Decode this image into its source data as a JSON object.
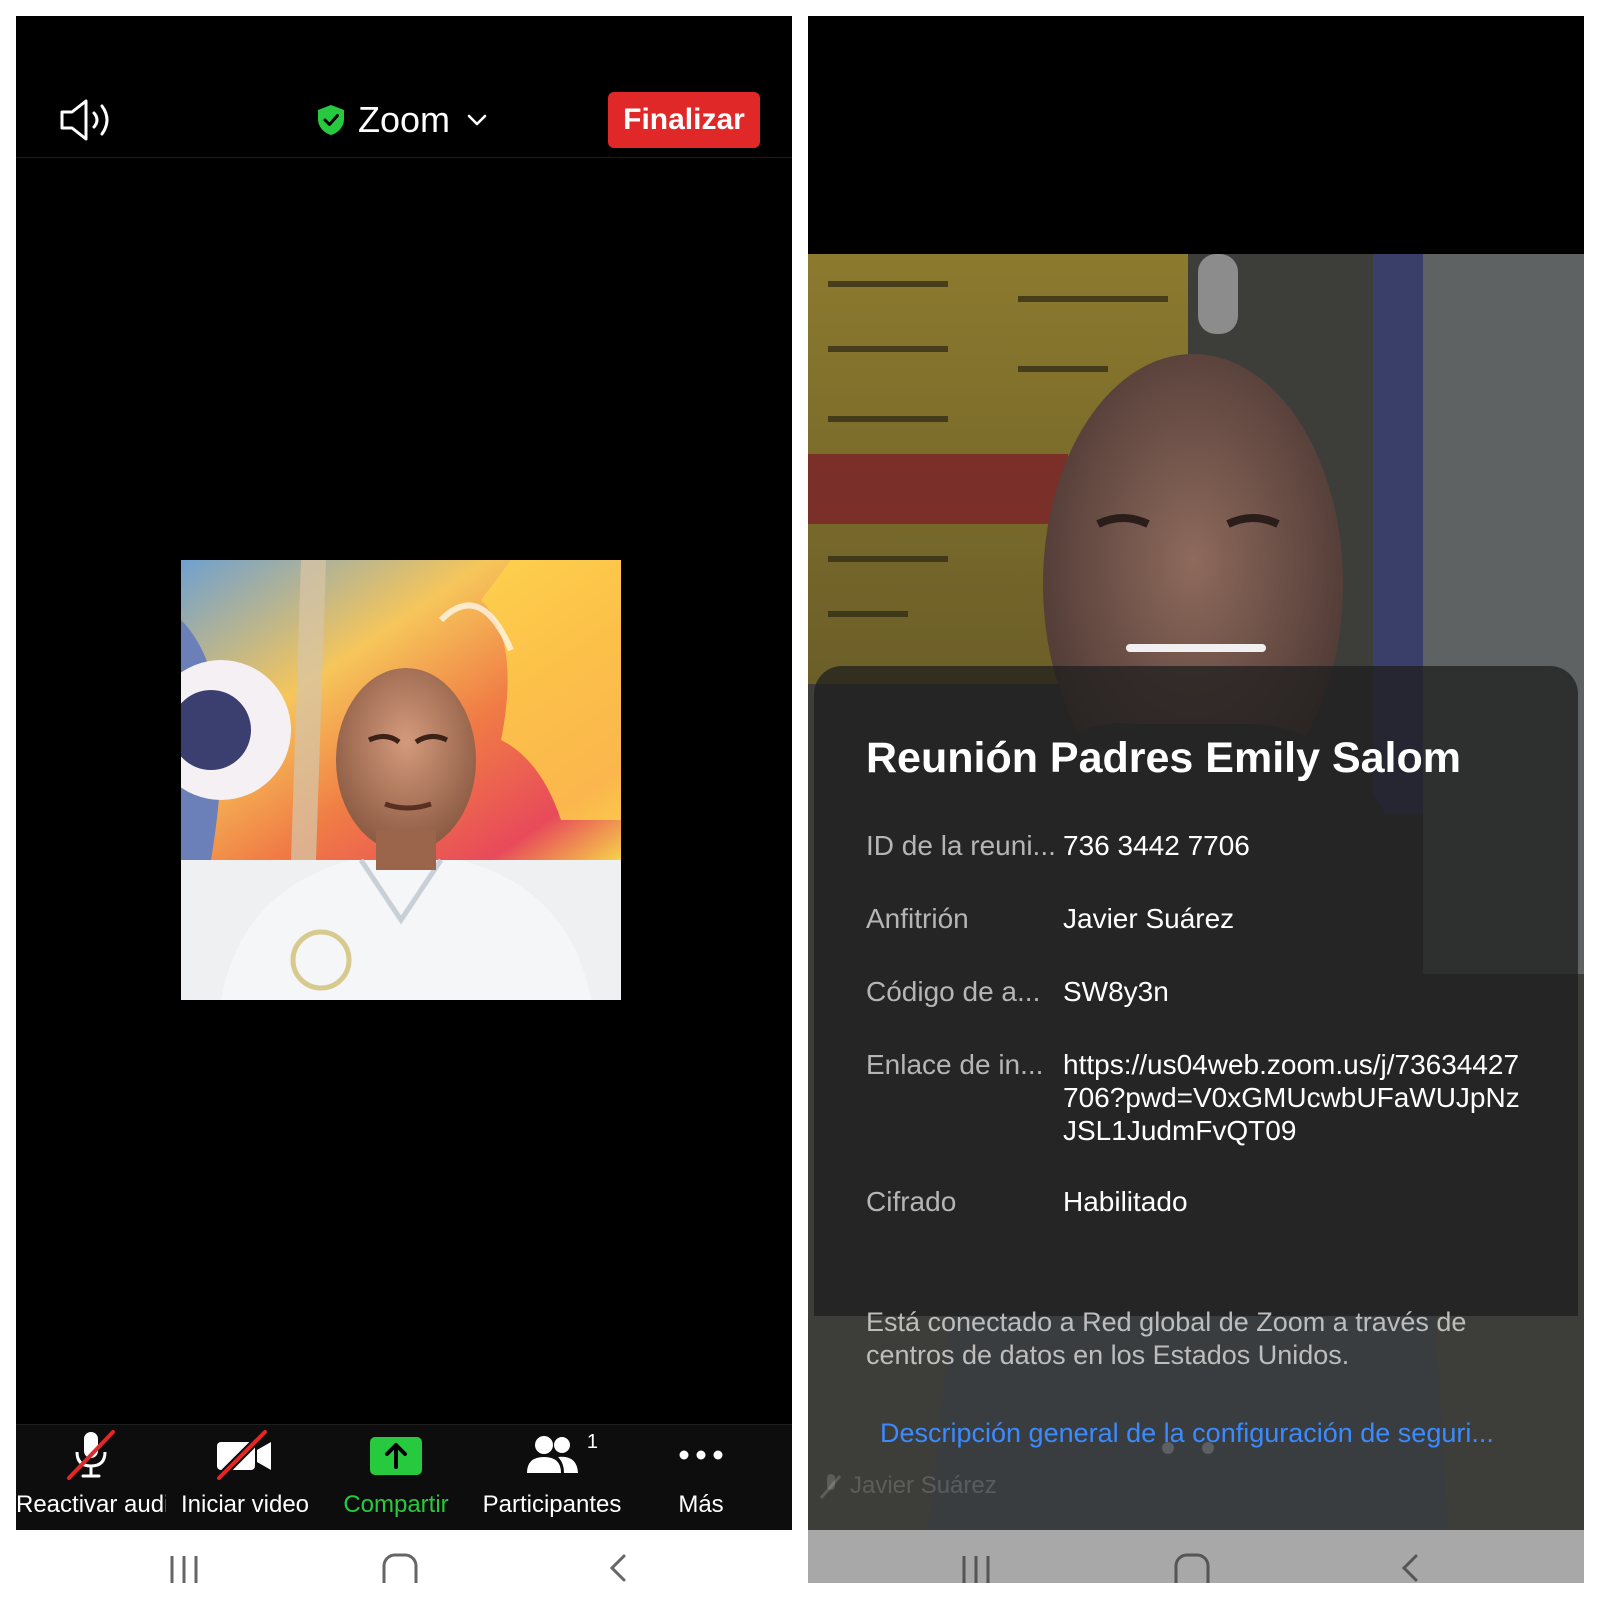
{
  "left": {
    "header": {
      "meeting_name": "Zoom",
      "end_button_label": "Finalizar",
      "speaker_icon": "speaker-icon",
      "shield_icon": "shield-check-icon",
      "shield_color": "#27c93f",
      "end_color": "#e02828"
    },
    "toolbar": {
      "items": [
        {
          "label": "Reactivar audio",
          "icon": "mic-muted-icon"
        },
        {
          "label": "Iniciar video",
          "icon": "video-off-icon"
        },
        {
          "label": "Compartir",
          "icon": "share-icon"
        },
        {
          "label": "Participantes",
          "icon": "participants-icon",
          "count": "1"
        },
        {
          "label": "Más",
          "icon": "more-icon"
        }
      ]
    }
  },
  "right": {
    "info_sheet": {
      "title": "Reunión Padres Emily Salom",
      "rows": [
        {
          "label": "ID de la reuni...",
          "value": "736 3442 7706"
        },
        {
          "label": "Anfitrión",
          "value": "Javier Suárez"
        },
        {
          "label": "Código de a...",
          "value": "SW8y3n"
        },
        {
          "label": "Enlace de in...",
          "value": "https://us04web.zoom.us/j/73634427706?pwd=V0xGMUcwbUFaWUJpNzJSL1JudmFvQT09"
        },
        {
          "label": "Cifrado",
          "value": "Habilitado"
        }
      ],
      "network_text": "Está conectado a Red global de Zoom a través de centros de datos en los Estados Unidos.",
      "security_link": "Descripción general de la configuración de seguri..."
    },
    "participant_name": "Javier Suárez"
  },
  "system_nav": {
    "icons": [
      "recents-icon",
      "home-icon",
      "back-icon"
    ]
  }
}
